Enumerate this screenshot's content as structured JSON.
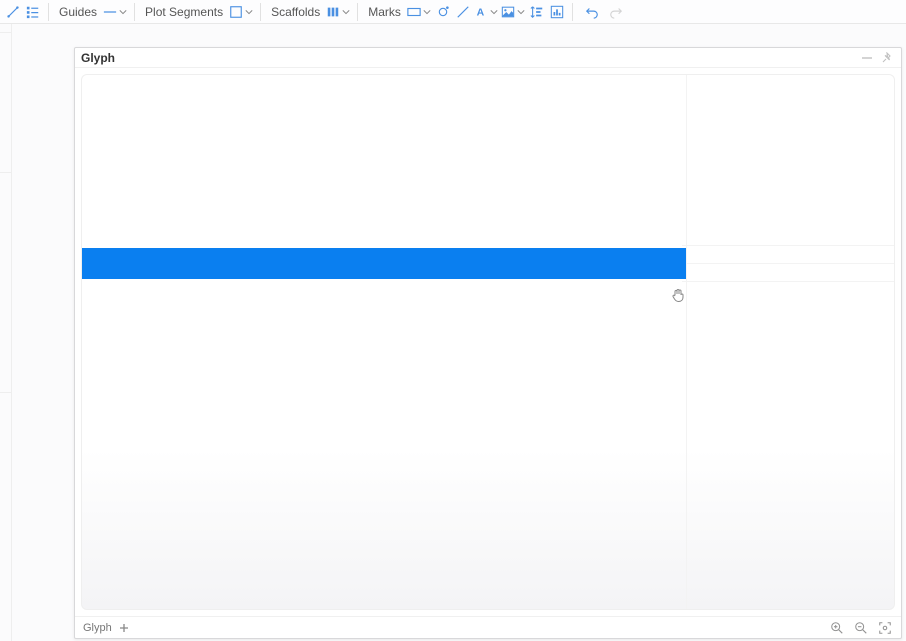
{
  "toolbar": {
    "guides_label": "Guides",
    "plot_segments_label": "Plot Segments",
    "scaffolds_label": "Scaffolds",
    "marks_label": "Marks"
  },
  "panel": {
    "title": "Glyph",
    "footer_tab": "Glyph"
  },
  "colors": {
    "accent": "#0a7ff0",
    "icon": "#4a90e2"
  }
}
